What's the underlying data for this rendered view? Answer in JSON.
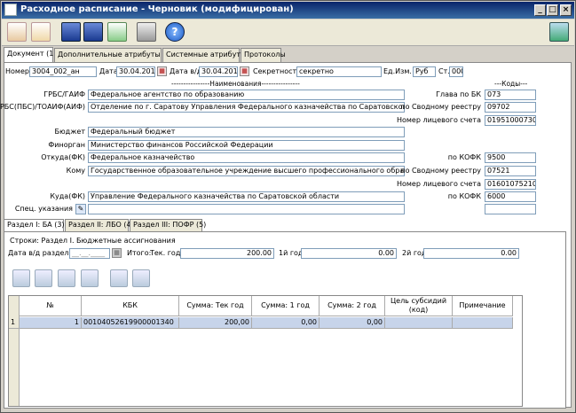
{
  "window": {
    "title": "Расходное расписание - Черновик (модифицирован)",
    "min": "_",
    "max": "□",
    "close": "×"
  },
  "toolbar": {
    "icons": [
      "new-doc-icon",
      "copy-doc-icon",
      "save-green-icon",
      "save-icon",
      "approve-icon",
      "print-icon",
      "help-icon",
      "exit-icon"
    ]
  },
  "tabs": [
    "Документ (1)",
    "Дополнительные атрибуты (2)",
    "Системные атрибуты",
    "Протоколы"
  ],
  "header": {
    "nomer_label": "Номер",
    "nomer": "3004_002_ан",
    "data_label": "Дата",
    "data": "30.04.2010",
    "data_vd_label": "Дата в/д",
    "data_vd": "30.04.2010",
    "secr_label": "Секретность",
    "secr": "секретно",
    "edizm_label": "Ед.Изм.",
    "edizm": "Руб",
    "st_label": "Ст.",
    "st": "000"
  },
  "sections": {
    "names": "----------------Наименования----------------",
    "codes": "---Коды---"
  },
  "form": {
    "grbs_label": "ГРБС/ГАИФ",
    "grbs": "Федеральное агентство по образованию",
    "glava_label": "Глава по БК",
    "glava": "073",
    "rbs_label": "РБС(ПБС)/ТОАИФ(АИФ)",
    "rbs": "Отделение по г. Саратову Управления Федерального казначейства по Саратовской области",
    "svod1_label": "по Сводному реестру",
    "svod1": "09702",
    "ls1_label": "Номер лицевого счета",
    "ls1": "01951000730",
    "budget_label": "Бюджет",
    "budget": "Федеральный бюджет",
    "finorg_label": "Финорган",
    "finorg": "Министерство финансов Российской Федерации",
    "otkuda_label": "Откуда(ФК)",
    "otkuda": "Федеральное казначейство",
    "kofk1_label": "по КОФК",
    "kofk1": "9500",
    "komu_label": "Кому",
    "komu": "Государственное образовательное учреждение высшего профессионального образования",
    "svod2_label": "по Сводному реестру",
    "svod2": "07521",
    "ls2_label": "Номер лицевого счета",
    "ls2": "01601075210",
    "kuda_label": "Куда(ФК)",
    "kuda": "Управление Федерального казначейства по Саратовской области",
    "kofk2_label": "по КОФК",
    "kofk2": "6000",
    "spec_label": "Спец. указания",
    "spec": ""
  },
  "subtabs": [
    "Раздел I: БА (3)",
    "Раздел II: ЛБО (4)",
    "Раздел III: ПОФР (5)"
  ],
  "section1": {
    "title": "Строки: Раздел I. Бюджетные ассигнования",
    "date_label": "Дата в/д раздела",
    "date": "__.__.____",
    "itogo_label": "Итого:",
    "tek_label": "Тек. год",
    "tek": "200.00",
    "y1_label": "1й год",
    "y1": "0.00",
    "y2_label": "2й год",
    "y2": "0.00"
  },
  "grid": {
    "columns": [
      "№",
      "КБК",
      "Сумма: Тек год",
      "Сумма: 1 год",
      "Сумма: 2 год",
      "Цель субсидий (код)",
      "Примечание"
    ],
    "rows": [
      {
        "rownum": "1",
        "n": "1",
        "kbk": "00104052619900001340",
        "tek": "200,00",
        "y1": "0,00",
        "y2": "0,00",
        "cel": "",
        "prim": ""
      }
    ]
  }
}
